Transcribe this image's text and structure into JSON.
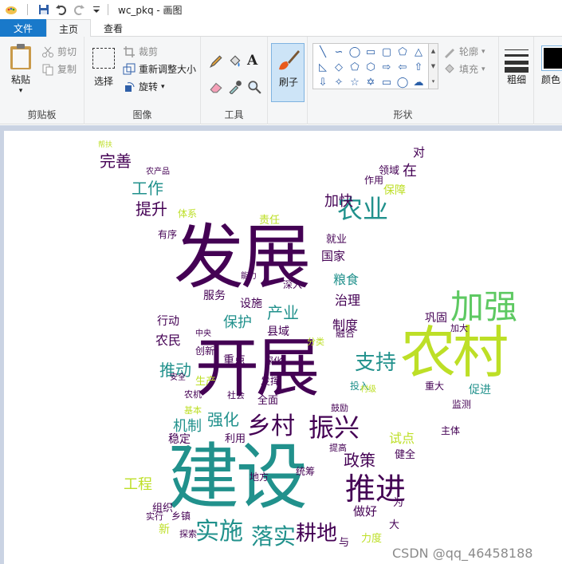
{
  "window": {
    "title": "wc_pkq - 画图"
  },
  "tabs": {
    "file": "文件",
    "home": "主页",
    "view": "查看"
  },
  "clipboard": {
    "paste": "粘贴",
    "cut": "剪切",
    "copy": "复制",
    "label": "剪贴板"
  },
  "image": {
    "select": "选择",
    "crop": "裁剪",
    "resize": "重新调整大小",
    "rotate": "旋转",
    "label": "图像"
  },
  "tools": {
    "label": "工具"
  },
  "brushes": {
    "label": "刷子"
  },
  "shapes": {
    "outline": "轮廓",
    "fill": "填充",
    "label": "形状"
  },
  "size": {
    "label": "粗细"
  },
  "color": {
    "label": "颜色"
  },
  "watermark": "CSDN @qq_46458188",
  "colors": {
    "accent": "#1979ca",
    "purple": "#440154",
    "teal": "#21918c",
    "green": "#5ec962",
    "yellow": "#bddf26"
  },
  "words": [
    "发展",
    "开展",
    "建设",
    "农村",
    "加强",
    "农业",
    "推进",
    "振兴",
    "乡村",
    "落实",
    "实施",
    "耕地",
    "支持",
    "完善",
    "工作",
    "提升",
    "产业",
    "保护",
    "推动",
    "强化",
    "机制",
    "政策",
    "粮食",
    "治理",
    "县域",
    "服务",
    "设施",
    "农民",
    "行动",
    "制度",
    "加快",
    "国家",
    "就业",
    "工程",
    "稳定",
    "利用",
    "试点",
    "巩固",
    "健全",
    "全面",
    "促进",
    "做好",
    "主体",
    "重点",
    "深入",
    "责任",
    "保障",
    "领域",
    "作用",
    "对",
    "在",
    "为",
    "大",
    "新",
    "与",
    "力度",
    "创新",
    "融合",
    "生产",
    "组织",
    "乡镇",
    "农产品",
    "帮扶",
    "地方",
    "能力",
    "安全",
    "发挥",
    "投入",
    "重大",
    "监测",
    "加大",
    "探索",
    "实行",
    "农机",
    "社会",
    "基本",
    "有序",
    "体系",
    "分类",
    "深化",
    "提高",
    "统筹",
    "鼓励",
    "村级",
    "中央",
    "管理",
    "农村",
    "标准",
    "地区"
  ]
}
